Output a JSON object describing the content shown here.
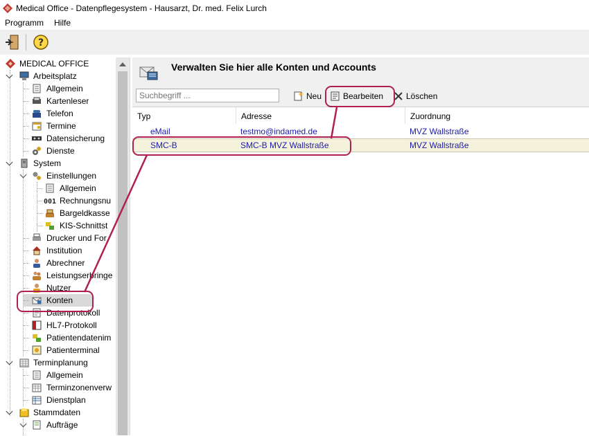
{
  "window": {
    "title": "Medical Office - Datenpflegesystem - Hausarzt, Dr. med. Felix Lurch"
  },
  "menu": [
    "Programm",
    "Hilfe"
  ],
  "tree": {
    "root": "MEDICAL OFFICE",
    "arbeitsplatz": "Arbeitsplatz",
    "arbeitsplatz_items": [
      "Allgemein",
      "Kartenleser",
      "Telefon",
      "Termine",
      "Datensicherung",
      "Dienste"
    ],
    "system": "System",
    "einstellungen": "Einstellungen",
    "einstellungen_items": [
      "Allgemein",
      "Rechnungsnu",
      "Bargeldkasse",
      "KIS-Schnittst"
    ],
    "system_items": [
      "Drucker und For",
      "Institution",
      "Abrechner",
      "Leistungserbringe",
      "Nutzer",
      "Konten",
      "Datenprotokoll",
      "HL7-Protokoll",
      "Patientendatenim",
      "Patienterminal"
    ],
    "terminplanung": "Terminplanung",
    "terminplanung_items": [
      "Allgemein",
      "Terminzonenverw",
      "Dienstplan"
    ],
    "stammdaten": "Stammdaten",
    "stammdaten_items": [
      "Aufträge"
    ]
  },
  "panel": {
    "title": "Verwalten Sie hier alle Konten und Accounts",
    "search_placeholder": "Suchbegriff ...",
    "new_label": "Neu",
    "edit_label": "Bearbeiten",
    "delete_label": "Löschen"
  },
  "table": {
    "columns": [
      "Typ",
      "Adresse",
      "Zuordnung"
    ],
    "rows": [
      {
        "typ": "eMail",
        "adresse": "testmo@indamed.de",
        "zuordnung": "MVZ Wallstraße"
      },
      {
        "typ": "SMC-B",
        "adresse": "SMC-B MVZ Wallstraße",
        "zuordnung": "MVZ Wallstraße"
      }
    ]
  },
  "colors": {
    "annotation": "#b0204e",
    "link_text": "#1a1ab0",
    "selected_row": "#f5f2dc"
  }
}
